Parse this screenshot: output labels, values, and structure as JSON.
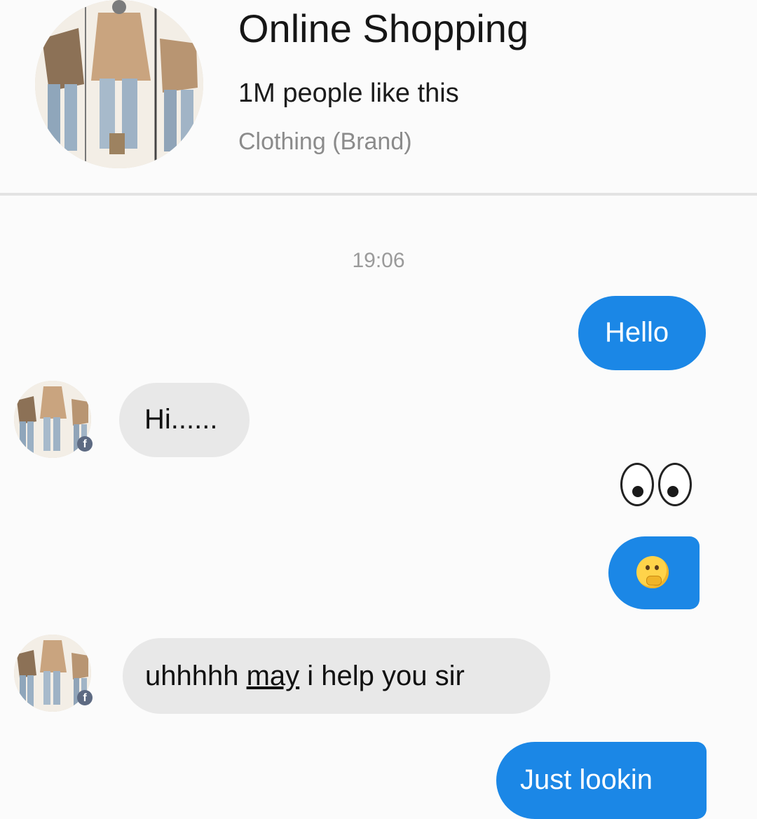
{
  "header": {
    "page_name": "Online Shopping",
    "likes": "1M people like this",
    "category": "Clothing (Brand)"
  },
  "conversation": {
    "timestamp": "19:06",
    "messages": [
      {
        "from": "me",
        "text": "Hello"
      },
      {
        "from": "page",
        "text": "Hi......"
      },
      {
        "from": "me",
        "emoji": "eyes"
      },
      {
        "from": "me",
        "emoji": "thinking-face"
      },
      {
        "from": "page",
        "text_before": "uhhhhh ",
        "text_underlined": "may",
        "text_after": " i help you sir"
      },
      {
        "from": "me",
        "text": "Just lookin"
      }
    ]
  },
  "colors": {
    "outgoing_bubble": "#1b87e6",
    "incoming_bubble": "#e8e8e8",
    "background": "#fbfbfb"
  }
}
